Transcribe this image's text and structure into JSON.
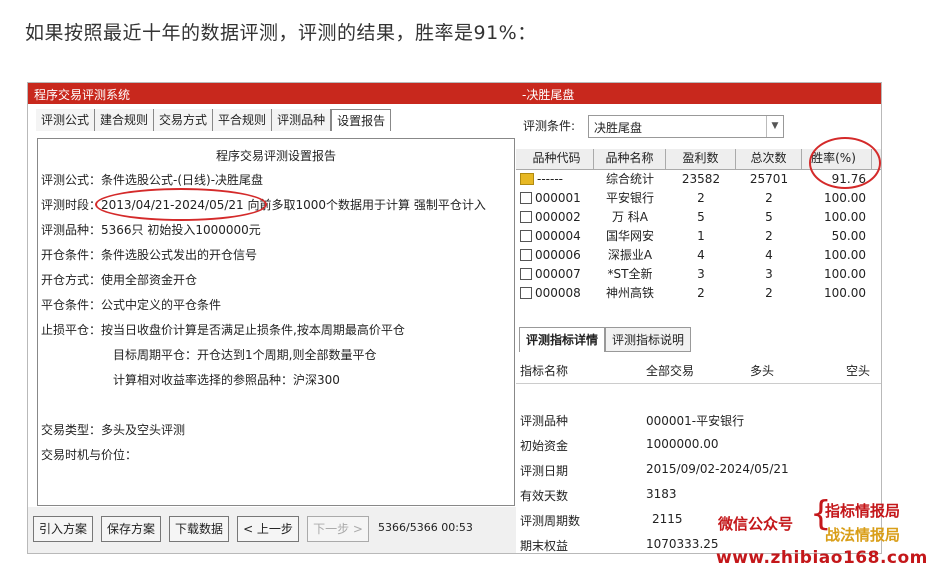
{
  "caption": "如果按照最近十年的数据评测，评测的结果，胜率是91%：",
  "left": {
    "title": "程序交易评测系统",
    "tabs": [
      "评测公式",
      "建合规则",
      "交易方式",
      "平合规则",
      "评测品种",
      "设置报告"
    ],
    "report": {
      "title": "程序交易评测设置报告",
      "lines": [
        "评测公式：条件选股公式-(日线)-决胜尾盘",
        "评测时段：2013/04/21-2024/05/21 向前多取1000个数据用于计算 强制平仓计入",
        "评测品种：5366只 初始投入1000000元",
        "开仓条件：条件选股公式发出的开仓信号",
        "开仓方式：使用全部资金开仓",
        "平仓条件：公式中定义的平仓条件",
        "止损平仓：按当日收盘价计算是否满足止损条件,按本周期最高价平仓",
        "目标周期平仓：开仓达到1个周期,则全部数量平仓",
        "计算相对收益率选择的参照品种：沪深300",
        "交易类型：多头及空头评测",
        "交易时机与价位："
      ]
    },
    "buttons": {
      "import": "引入方案",
      "save": "保存方案",
      "download": "下载数据",
      "prev": "< 上一步",
      "next": "下一步 >"
    },
    "status": "5366/5366  00:53"
  },
  "right": {
    "title": "-决胜尾盘",
    "cond_label": "评测条件:",
    "cond_value": "决胜尾盘",
    "grid_headers": [
      "品种代码",
      "品种名称",
      "盈利数",
      "总次数",
      "胜率(%)"
    ],
    "grid_rows": [
      [
        "------",
        "综合统计",
        "23582",
        "25701",
        "91.76"
      ],
      [
        "000001",
        "平安银行",
        "2",
        "2",
        "100.00"
      ],
      [
        "000002",
        "万 科A",
        "5",
        "5",
        "100.00"
      ],
      [
        "000004",
        "国华网安",
        "1",
        "2",
        "50.00"
      ],
      [
        "000006",
        "深振业A",
        "4",
        "4",
        "100.00"
      ],
      [
        "000007",
        "*ST全新",
        "3",
        "3",
        "100.00"
      ],
      [
        "000008",
        "神州高铁",
        "2",
        "2",
        "100.00"
      ]
    ],
    "tabs": [
      "评测指标详情",
      "评测指标说明"
    ],
    "detail_headers": [
      "指标名称",
      "全部交易",
      "多头",
      "空头"
    ],
    "detail_rows": [
      [
        "评测品种",
        "000001-平安银行"
      ],
      [
        "初始资金",
        "1000000.00"
      ],
      [
        "评测日期",
        "2015/09/02-2024/05/21"
      ],
      [
        "有效天数",
        "3183"
      ],
      [
        "评测周期数",
        "2115"
      ],
      [
        "期末权益",
        "1070333.25"
      ]
    ]
  },
  "watermark": {
    "left": "微信公众号",
    "right_top": "指标情报局",
    "right_bottom": "战法情报局",
    "url": "www.zhibiao168.com"
  },
  "colors": {
    "title_bar": "#c8281d",
    "highlight_circle": "#d42a2a",
    "watermark_red": "#c4171a",
    "watermark_gold": "#d99e18"
  }
}
